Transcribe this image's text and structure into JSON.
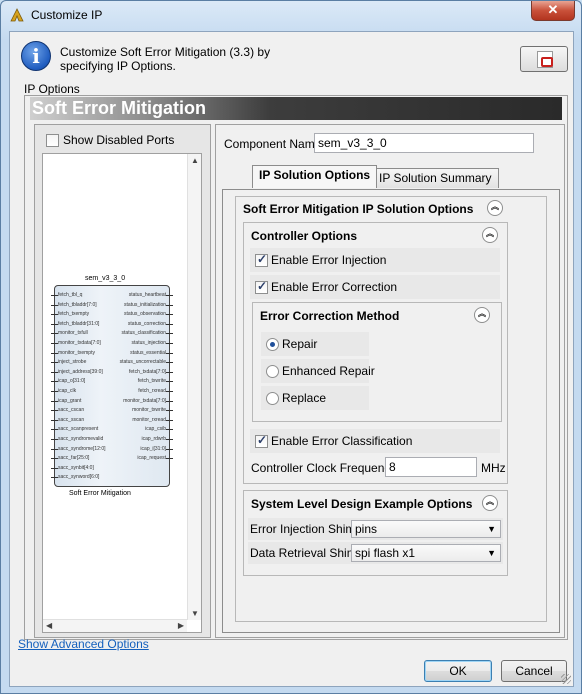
{
  "window": {
    "title": "Customize IP",
    "close_glyph": "✕"
  },
  "header": {
    "description": "Customize Soft Error Mitigation (3.3) by specifying IP Options.",
    "info_icon_glyph": "i"
  },
  "ip_options_label": "IP Options",
  "banner_title": "Soft Error Mitigation",
  "left_pane": {
    "show_disabled_ports_label": "Show Disabled Ports",
    "show_disabled_ports_checked": false,
    "symbol_name": "sem_v3_3_0",
    "symbol_footer": "Soft Error Mitigation",
    "left_pins": [
      "fetch_tbl_q",
      "fetch_tbladdr[7:0]",
      "fetch_txempty",
      "fetch_tbladdr[31:0]",
      "monitor_txfull",
      "monitor_txdata[7:0]",
      "monitor_txempty",
      "inject_strobe",
      "inject_address[39:0]",
      "icap_o[31:0]",
      "icap_clk",
      "icap_grant",
      "sacc_cscan",
      "sacc_sscan",
      "sacc_scanpresent",
      "sacc_syndromevalid",
      "sacc_syndrome[12:0]",
      "sacc_far[25:0]",
      "sacc_synbit[4:0]",
      "sacc_synword[6:0]"
    ],
    "right_pins": [
      "status_heartbeat",
      "status_initialization",
      "status_observation",
      "status_correction",
      "status_classification",
      "status_injection",
      "status_essential",
      "status_uncorrectable",
      "fetch_txdata[7:0]",
      "fetch_txwrite",
      "fetch_rxread",
      "monitor_txdata[7:0]",
      "monitor_txwrite",
      "monitor_rxread",
      "icap_csib",
      "icap_rdwrb",
      "icap_i[31:0]",
      "icap_request"
    ]
  },
  "right_pane": {
    "component_name_label": "Component Name",
    "component_name_value": "sem_v3_3_0",
    "tabs": [
      {
        "label": "IP Solution Options",
        "active": true
      },
      {
        "label": "IP Solution Summary",
        "active": false
      }
    ],
    "solution_options_title": "Soft Error Mitigation IP Solution Options",
    "controller_options": {
      "title": "Controller Options",
      "enable_error_injection": {
        "label": "Enable Error Injection",
        "checked": true
      },
      "enable_error_correction": {
        "label": "Enable Error Correction",
        "checked": true
      },
      "error_correction_method": {
        "title": "Error Correction Method",
        "options": [
          {
            "label": "Repair",
            "selected": true
          },
          {
            "label": "Enhanced Repair",
            "selected": false
          },
          {
            "label": "Replace",
            "selected": false
          }
        ]
      },
      "enable_error_classification": {
        "label": "Enable Error Classification",
        "checked": true
      },
      "clock_frequency": {
        "label": "Controller Clock Frequency",
        "value": "8",
        "unit": "MHz"
      }
    },
    "system_level": {
      "title": "System Level Design Example Options",
      "error_injection_shim": {
        "label": "Error Injection Shim",
        "value": "pins"
      },
      "data_retrieval_shim": {
        "label": "Data Retrieval Shim",
        "value": "spi flash x1"
      }
    }
  },
  "footer": {
    "advanced_link": "Show Advanced Options",
    "ok_label": "OK",
    "cancel_label": "Cancel"
  },
  "icons": {
    "collapse_glyph": "︽",
    "dropdown_glyph": "▼"
  }
}
